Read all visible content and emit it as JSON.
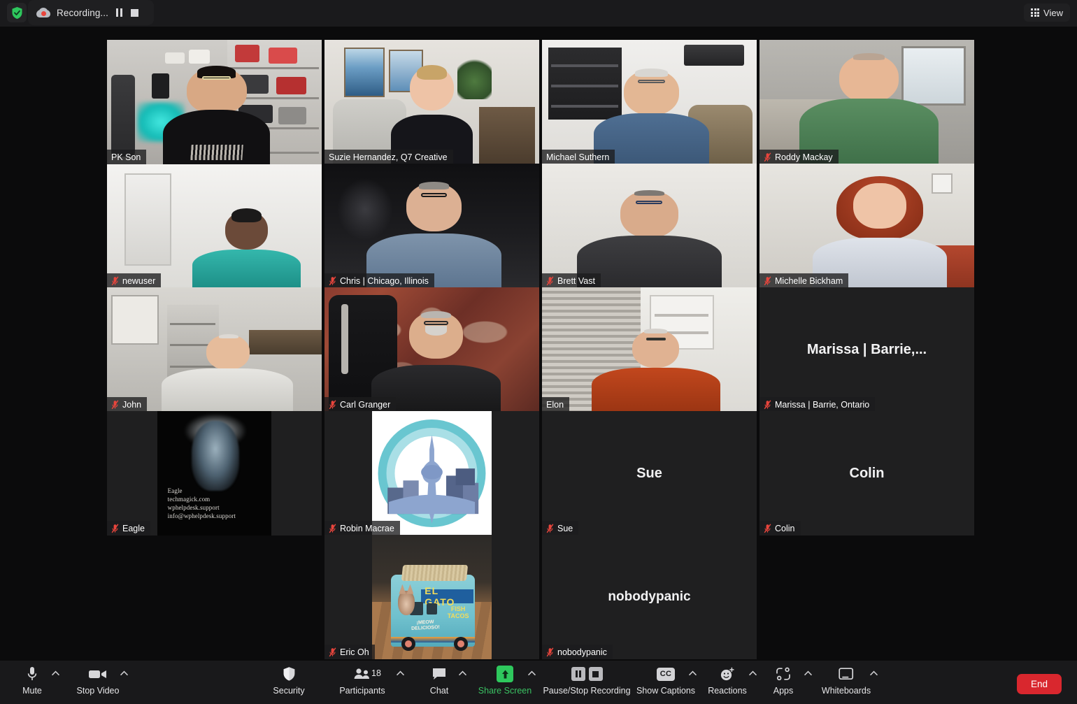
{
  "topbar": {
    "shield_icon": "shield-check-icon",
    "recording_label": "Recording...",
    "pause_icon": "pause-icon",
    "stop_icon": "stop-icon",
    "view_label": "View",
    "view_icon": "grid-view-icon"
  },
  "grid": {
    "active_speaker": "PK Son",
    "participants": [
      {
        "name": "PK Son",
        "muted": false,
        "active": true,
        "display": "video",
        "row": 0,
        "col": 0
      },
      {
        "name": "Suzie Hernandez, Q7 Creative",
        "muted": false,
        "active": false,
        "display": "video",
        "row": 0,
        "col": 1
      },
      {
        "name": "Michael Suthern",
        "muted": false,
        "active": false,
        "display": "video",
        "row": 0,
        "col": 2
      },
      {
        "name": "Roddy Mackay",
        "muted": true,
        "active": false,
        "display": "video",
        "row": 0,
        "col": 3
      },
      {
        "name": "newuser",
        "muted": true,
        "active": false,
        "display": "video",
        "row": 1,
        "col": 0
      },
      {
        "name": "Chris | Chicago, Illinois",
        "muted": true,
        "active": false,
        "display": "video",
        "row": 1,
        "col": 1
      },
      {
        "name": "Brett Vast",
        "muted": true,
        "active": false,
        "display": "video",
        "row": 1,
        "col": 2
      },
      {
        "name": "Michelle Bickham",
        "muted": true,
        "active": false,
        "display": "video",
        "row": 1,
        "col": 3
      },
      {
        "name": "John",
        "muted": true,
        "active": false,
        "display": "video",
        "row": 2,
        "col": 0
      },
      {
        "name": "Carl Granger",
        "muted": true,
        "active": false,
        "display": "video",
        "row": 2,
        "col": 1
      },
      {
        "name": "Elon",
        "muted": false,
        "active": false,
        "display": "video",
        "row": 2,
        "col": 2
      },
      {
        "name": "Marissa | Barrie, Ontario",
        "muted": true,
        "active": false,
        "display": "name",
        "center_text": "Marissa | Barrie,...",
        "row": 2,
        "col": 3
      },
      {
        "name": "Eagle",
        "muted": true,
        "active": false,
        "display": "avatar",
        "row": 3,
        "col": 0
      },
      {
        "name": "Robin Macrae",
        "muted": true,
        "active": false,
        "display": "avatar",
        "row": 3,
        "col": 1
      },
      {
        "name": "Sue",
        "muted": true,
        "active": false,
        "display": "name",
        "center_text": "Sue",
        "row": 3,
        "col": 2
      },
      {
        "name": "Colin",
        "muted": true,
        "active": false,
        "display": "name",
        "center_text": "Colin",
        "row": 3,
        "col": 3
      },
      {
        "name": "Eric Oh",
        "muted": true,
        "active": false,
        "display": "avatar",
        "row": 4,
        "col": 1
      },
      {
        "name": "nobodypanic",
        "muted": true,
        "active": false,
        "display": "name",
        "center_text": "nobodypanic",
        "row": 4,
        "col": 2
      }
    ],
    "eagle_avatar_text": "Eagle\ntechmagick.com\nwphelpdesk.support\ninfo@wphelpdesk.support",
    "eric_truck_text": {
      "brand": "EL GATO",
      "sub": "FISH\nTACOS",
      "tagline": "¡MEOW\nDELICIOSO!"
    }
  },
  "toolbar": {
    "mute_label": "Mute",
    "mute_icon": "microphone-icon",
    "video_label": "Stop Video",
    "video_icon": "camera-icon",
    "security_label": "Security",
    "security_icon": "shield-icon",
    "participants_label": "Participants",
    "participants_icon": "people-icon",
    "participants_count": "18",
    "chat_label": "Chat",
    "chat_icon": "chat-bubble-icon",
    "share_label": "Share Screen",
    "share_icon": "share-arrow-up-icon",
    "recording_label": "Pause/Stop Recording",
    "recording_pause_icon": "pause-icon",
    "recording_stop_icon": "stop-icon",
    "captions_label": "Show Captions",
    "captions_icon": "cc-icon",
    "reactions_label": "Reactions",
    "reactions_icon": "smiley-plus-icon",
    "apps_label": "Apps",
    "apps_icon": "apps-icon",
    "whiteboards_label": "Whiteboards",
    "whiteboards_icon": "whiteboard-icon",
    "end_label": "End",
    "caret_icon": "chevron-up-icon"
  },
  "colors": {
    "accent_green": "#3ac162",
    "end_red": "#d9272e",
    "active_border": "#c9e265",
    "muted_red": "#e8453c",
    "background": "#0b0b0c"
  }
}
